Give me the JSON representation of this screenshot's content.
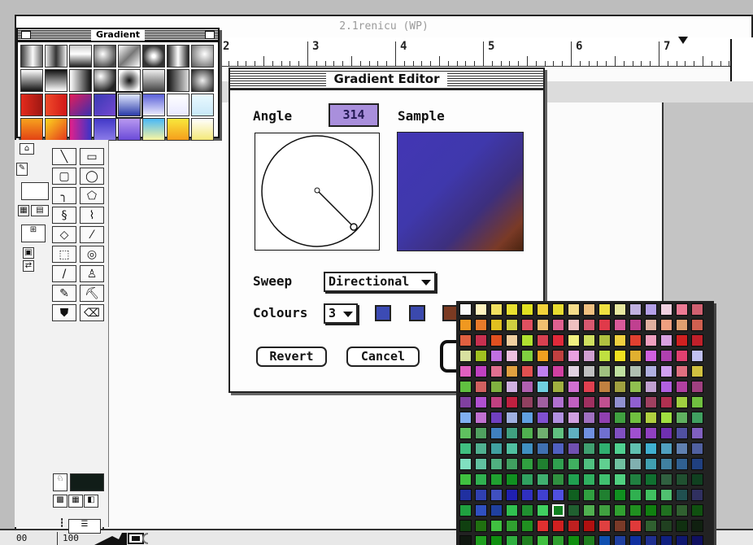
{
  "document": {
    "title": "2.1renicu (WP)",
    "ruler_numbers": [
      "2",
      "3",
      "4",
      "5",
      "6",
      "7"
    ]
  },
  "status_bar": {
    "left_value": "00",
    "zoom": "100"
  },
  "gradient_palette": {
    "title": "Gradient",
    "swatches": [
      "linear-gradient(90deg,#3a3a3a,#fafafa 55%,#666)",
      "linear-gradient(90deg,#eee,#333 50%,#eee)",
      "linear-gradient(180deg,#ccc,#fff 40%,#222)",
      "radial-gradient(circle at 40% 40%,#fff,#444 80%)",
      "linear-gradient(135deg,#fff,#777 50%,#fff)",
      "radial-gradient(circle,#fff 10%,#333 70%)",
      "linear-gradient(90deg,#222,#fff 50%,#222)",
      "radial-gradient(circle at 60% 40%,#fff,#555)",
      "linear-gradient(180deg,#fff,#111)",
      "linear-gradient(180deg,#111,#fff)",
      "linear-gradient(90deg,#fff,#111)",
      "radial-gradient(circle at 30% 30%,#fff,#222 75%)",
      "radial-gradient(circle at 50% 50%,#111,#fff 80%)",
      "linear-gradient(180deg,#eee,#444)",
      "linear-gradient(90deg,#111,#ddd)",
      "radial-gradient(circle,#eee,#222)",
      "linear-gradient(90deg,#e42a1c,#9e1813)",
      "linear-gradient(90deg,#f04a2a,#d01818)",
      "linear-gradient(135deg,#e41c5a,#3a2fb0)",
      "linear-gradient(135deg,#3a3ab5,#7448d0)",
      "linear-gradient(180deg,#e0e8ff,#2a3aa8)",
      "linear-gradient(180deg,#5a60d8,#eeeeff)",
      "linear-gradient(180deg,#fff,#e8e8ff)",
      "linear-gradient(180deg,#eafaff,#c8e8f8)",
      "linear-gradient(180deg,#f7a21e,#e24214)",
      "linear-gradient(135deg,#fdd61e,#e4371c)",
      "linear-gradient(90deg,#e2208a,#3a34c8)",
      "linear-gradient(180deg,#4238c8,#8b7be8)",
      "linear-gradient(180deg,#b898f0,#6a4ad8)",
      "linear-gradient(180deg,#48b8f8,#faf6a0)",
      "linear-gradient(180deg,#f9e83c,#f59e1c)",
      "linear-gradient(180deg,#fff,#f4e878)"
    ],
    "selected_index": 20
  },
  "gradient_editor": {
    "title": "Gradient Editor",
    "angle_label": "Angle",
    "angle_value": "314",
    "sample_label": "Sample",
    "sweep_label": "Sweep",
    "sweep_value": "Directional",
    "colours_label": "Colours",
    "colours_value": "3",
    "colour_wells": [
      "#3c4bb4",
      "#3b49ad",
      "#7a3a22"
    ],
    "revert_label": "Revert",
    "cancel_label": "Cancel"
  },
  "colour_palette": {
    "selected_index": 214,
    "colors": [
      "#fafafa",
      "#fff3c0",
      "#f0e060",
      "#e8e030",
      "#e0e020",
      "#f2d23a",
      "#e8dc30",
      "#f5dc8a",
      "#f0c080",
      "#eee040",
      "#e8e8a0",
      "#c0b0e0",
      "#b4a0e8",
      "#f0d0e0",
      "#ec7a94",
      "#d06070",
      "#f09820",
      "#e87a2a",
      "#e0c020",
      "#d0d040",
      "#e05060",
      "#f0c070",
      "#e06090",
      "#f0c0c0",
      "#d85870",
      "#e03a4a",
      "#d85a9a",
      "#c04090",
      "#e0b0a0",
      "#f0a080",
      "#e0a070",
      "#d06050",
      "#e06040",
      "#c83050",
      "#e05020",
      "#f0d0a0",
      "#b0e030",
      "#d84050",
      "#e02a3a",
      "#f0f080",
      "#d0e060",
      "#b0c040",
      "#f0d040",
      "#e04030",
      "#f0a0c0",
      "#d8a0e0",
      "#d02020",
      "#c0202a",
      "#d8e0a0",
      "#a0c020",
      "#c070e0",
      "#f0c0e0",
      "#80d040",
      "#f0a020",
      "#c04040",
      "#e8a0e0",
      "#d0a0d0",
      "#c0e040",
      "#f0e020",
      "#e0b030",
      "#d060e0",
      "#b040b0",
      "#e04070",
      "#c0c0f0",
      "#e060c0",
      "#c040c0",
      "#e07090",
      "#e0a040",
      "#e05050",
      "#c080f0",
      "#d040a0",
      "#e0d0e0",
      "#c0c0c0",
      "#a0c080",
      "#c0e0a0",
      "#b0c0b0",
      "#b0b0e0",
      "#d0a0f0",
      "#e07080",
      "#d0c040",
      "#60c040",
      "#d06060",
      "#80b040",
      "#d0b0e0",
      "#b060b0",
      "#70d0e0",
      "#a0b040",
      "#d070d0",
      "#e04050",
      "#c08040",
      "#a0a040",
      "#90c050",
      "#c0a0d0",
      "#b060e0",
      "#b040a0",
      "#a04080",
      "#8040a0",
      "#b050d0",
      "#c04080",
      "#c02040",
      "#904060",
      "#a060a0",
      "#b070d0",
      "#c060c0",
      "#a03060",
      "#c05090",
      "#9090d0",
      "#9060d0",
      "#a04060",
      "#b03050",
      "#a0d040",
      "#70c040",
      "#80b0f0",
      "#c070d0",
      "#7040c0",
      "#a0b0e0",
      "#60a0e0",
      "#8050d0",
      "#b090e0",
      "#d0a0e0",
      "#a070c0",
      "#9040b0",
      "#40a040",
      "#70c040",
      "#b0d040",
      "#a0e040",
      "#60b060",
      "#40a060",
      "#60c060",
      "#50a060",
      "#4080c0",
      "#40a080",
      "#50b050",
      "#70b070",
      "#60c080",
      "#60b0c0",
      "#7090e0",
      "#7070d0",
      "#8050c0",
      "#a050d0",
      "#9040c0",
      "#7030b0",
      "#5050a0",
      "#8060c0",
      "#40c080",
      "#50b090",
      "#40a0a0",
      "#50c0a0",
      "#4090c0",
      "#4070b0",
      "#5060c0",
      "#7050b0",
      "#40a070",
      "#30b070",
      "#50d090",
      "#60c0b0",
      "#40b0d0",
      "#50a0c0",
      "#6080b0",
      "#5060a0",
      "#80e0c0",
      "#60c0a0",
      "#50b080",
      "#40a060",
      "#30a040",
      "#208030",
      "#30a050",
      "#40b060",
      "#50c080",
      "#60d090",
      "#70c0a0",
      "#80b0b0",
      "#40a0b0",
      "#4080a0",
      "#306090",
      "#204080",
      "#40c040",
      "#30b050",
      "#20a030",
      "#109020",
      "#30a060",
      "#40b070",
      "#309040",
      "#20a050",
      "#30b060",
      "#40c070",
      "#50d080",
      "#208040",
      "#107030",
      "#306040",
      "#205030",
      "#104020",
      "#2030a0",
      "#3040b0",
      "#4050c0",
      "#2020b0",
      "#3030c0",
      "#4040d0",
      "#5050e0",
      "#106020",
      "#30a040",
      "#208030",
      "#109020",
      "#30b050",
      "#40c060",
      "#50c070",
      "#205050",
      "#303060",
      "#20a040",
      "#3050c0",
      "#2040a0",
      "#30c050",
      "#209030",
      "#40d060",
      "#108020",
      "#206030",
      "#50b050",
      "#40a040",
      "#30a030",
      "#209020",
      "#108010",
      "#207020",
      "#306030",
      "#105010",
      "#104010",
      "#207010",
      "#40c040",
      "#30a030",
      "#209020",
      "#e03030",
      "#d02020",
      "#c02020",
      "#b01010",
      "#e04040",
      "#7a3a28",
      "#e03a3a",
      "#306030",
      "#204020",
      "#103010",
      "#102010",
      "#101810",
      "#20a020",
      "#109010",
      "#30b040",
      "#208020",
      "#40c040",
      "#30a030",
      "#109010",
      "#208020",
      "#1050b0",
      "#2040a0",
      "#1030a0",
      "#203090",
      "#102080",
      "#101870",
      "#101060",
      "#e0e0ff",
      "#d0d0f0",
      "#c0c0e0",
      "#b0b0d0",
      "#ffffff",
      "#f0f0f0",
      "#e0e0e0",
      "#d0d0d0",
      "#c0c0c0",
      "#b0b0b0",
      "#a0a0a0",
      "#909090",
      "#808080",
      "#606060",
      "#404040",
      "#202020"
    ]
  },
  "toolbox": {
    "tools": [
      "line-tool",
      "rectangle-tool",
      "rounded-rectangle-tool",
      "oval-tool",
      "arc-tool",
      "polygon-tool",
      "spiral-tool",
      "freehand-tool",
      "diamond-tool",
      "eyedropper-tool",
      "marquee-tool",
      "lasso-tool",
      "knife-tool",
      "flask-tool",
      "pen-tool",
      "bucket-tool",
      "paint-tool",
      "eraser-tool"
    ],
    "glyphs": [
      "╲",
      "▭",
      "▢",
      "◯",
      "╮",
      "⬠",
      "§",
      "⌇",
      "◇",
      "⁄",
      "⬚",
      "◎",
      "/",
      "♙",
      "✎",
      "⛏",
      "⛊",
      "⌫"
    ]
  }
}
